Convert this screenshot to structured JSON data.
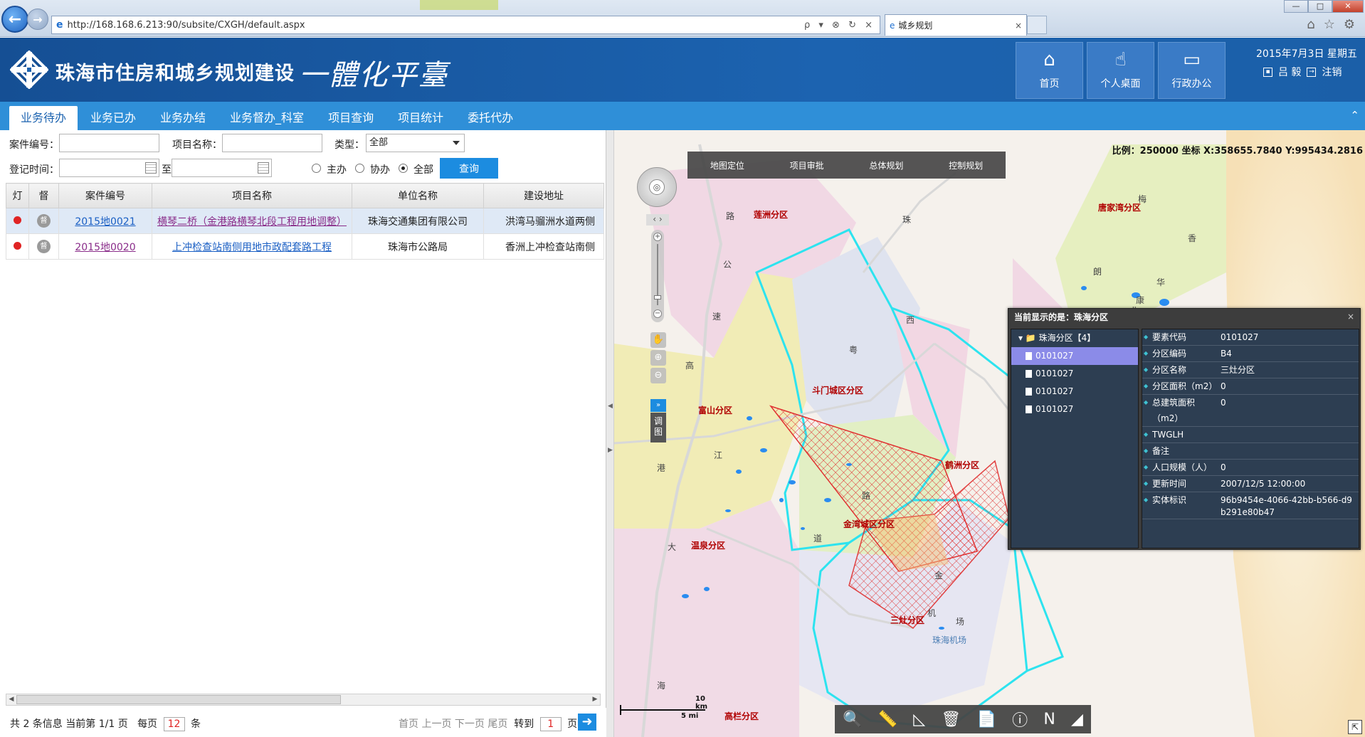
{
  "browser": {
    "url": "http://168.168.6.213:90/subsite/CXGH/default.aspx",
    "tab_title": "城乡规划",
    "addr_tools": "ρ ▾ ⊗ ↻ ×",
    "tab_close": "×",
    "tools": [
      "⌂",
      "☆",
      "⚙"
    ],
    "win": [
      "—",
      "□",
      "✕"
    ]
  },
  "header": {
    "title": "珠海市住房和城乡规划建设",
    "slogan": "一體化平臺",
    "tiles": [
      {
        "label": "首页",
        "icon": "⌂"
      },
      {
        "label": "个人桌面",
        "icon": "☝"
      },
      {
        "label": "行政办公",
        "icon": "▭"
      }
    ],
    "date": "2015年7月3日 星期五",
    "user": "吕 毅",
    "logout": "注销"
  },
  "subtabs": [
    "业务待办",
    "业务已办",
    "业务办结",
    "业务督办_科室",
    "项目查询",
    "项目统计",
    "委托代办"
  ],
  "collapse_icon": "⌃",
  "filter": {
    "case_no_label": "案件编号：",
    "project_name_label": "项目名称：",
    "type_label": "类型：",
    "type_value": "全部",
    "reg_time_label": "登记时间：",
    "to_label": "至",
    "radios": [
      "主办",
      "协办",
      "全部"
    ],
    "radio_selected": "全部",
    "query_label": "查询"
  },
  "grid": {
    "columns": [
      "灯",
      "督",
      "案件编号",
      "项目名称",
      "单位名称",
      "建设地址"
    ],
    "rows": [
      {
        "case_no": "2015地0021",
        "project": "横琴二桥（金港路横琴北段工程用地调整）",
        "unit": "珠海交通集团有限公司",
        "address": "洪湾马骝洲水道两侧",
        "du": "督"
      },
      {
        "case_no": "2015地0020",
        "project": "上冲检查站南侧用地市政配套路工程",
        "unit": "珠海市公路局",
        "address": "香洲上冲检查站南侧",
        "du": "督"
      }
    ]
  },
  "pager": {
    "summary": "共 2 条信息 当前第 1/1 页",
    "per_page_label": "每页",
    "per_page": "12",
    "per_page_unit": "条",
    "nav": "首页 上一页 下一页 尾页",
    "goto_label": "转到",
    "goto_page": "1",
    "goto_unit": "页",
    "go_icon": "➜"
  },
  "map": {
    "scale_info": "比例：250000 坐标 X:358655.7840 Y:995434.2816",
    "topbar": [
      "地图定位",
      "项目审批",
      "总体规划",
      "控制规划"
    ],
    "districts": [
      "莲洲分区",
      "唐家湾分区",
      "斗门城区分区",
      "富山分区",
      "鹤洲分区",
      "金湾城区分区",
      "温泉分区",
      "三灶分区",
      "高栏分区"
    ],
    "road_labels": [
      "珠",
      "路",
      "公",
      "速",
      "高",
      "西",
      "粤",
      "江",
      "港",
      "道",
      "大",
      "海",
      "路",
      "金",
      "机",
      "场",
      "珠海机场",
      "梅",
      "香",
      "朗",
      "北",
      "康",
      "华"
    ],
    "tiaotu": "调图",
    "expand": "»",
    "scalebar_km": "10 km",
    "scalebar_mi": "5 mi",
    "toolbar_icons": [
      "search-icon",
      "ruler-icon",
      "triangle-icon",
      "trash-icon",
      "add-doc-icon",
      "info-icon",
      "network-icon",
      "eraser-icon"
    ],
    "toolbar_glyphs": [
      "🔍",
      "📏",
      "◺",
      "🗑",
      "📄",
      "ⓘ",
      "Ν",
      "◢"
    ],
    "nav_center": "◎",
    "pan": "‹ ›",
    "zoom_plus": "+",
    "zoom_minus": "−",
    "tool_glyphs": [
      "✋",
      "⊕",
      "⊖"
    ],
    "corner": "⇱"
  },
  "info_panel": {
    "title": "当前显示的是：珠海分区",
    "close": "×",
    "tree_root": "▾ 📁 珠海分区【4】",
    "tree_items": [
      "0101027",
      "0101027",
      "0101027",
      "0101027"
    ],
    "attrs": [
      {
        "k": "要素代码",
        "v": "0101027"
      },
      {
        "k": "分区编码",
        "v": "B4"
      },
      {
        "k": "分区名称",
        "v": "三灶分区"
      },
      {
        "k": "分区面积（m2）",
        "v": "0"
      },
      {
        "k": "总建筑面积（m2）",
        "v": "0"
      },
      {
        "k": "TWGLH",
        "v": ""
      },
      {
        "k": "备注",
        "v": ""
      },
      {
        "k": "人口规模（人）",
        "v": "0"
      },
      {
        "k": "更新时间",
        "v": "2007/12/5 12:00:00"
      },
      {
        "k": "实体标识",
        "v": "96b9454e-4066-42bb-b566-d9b291e80b47"
      }
    ]
  }
}
